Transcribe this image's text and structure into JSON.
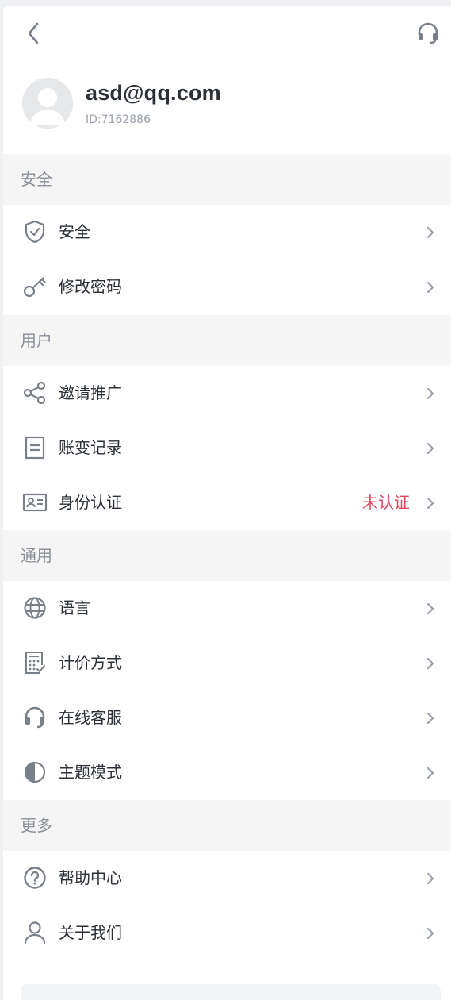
{
  "header": {
    "back_icon": "chevron-left-icon",
    "support_icon": "headset-icon"
  },
  "profile": {
    "email": "asd@qq.com",
    "uid": "ID:7162886"
  },
  "sections": {
    "security": {
      "title": "安全",
      "items": [
        {
          "label": "安全",
          "icon": "shield-icon"
        },
        {
          "label": "修改密码",
          "icon": "key-icon"
        }
      ]
    },
    "user": {
      "title": "用户",
      "items": [
        {
          "label": "邀请推广",
          "icon": "share-icon"
        },
        {
          "label": "账变记录",
          "icon": "document-icon"
        },
        {
          "label": "身份认证",
          "icon": "id-card-icon",
          "status": "未认证"
        }
      ]
    },
    "general": {
      "title": "通用",
      "items": [
        {
          "label": "语言",
          "icon": "globe-icon"
        },
        {
          "label": "计价方式",
          "icon": "calculator-icon"
        },
        {
          "label": "在线客服",
          "icon": "headset-icon"
        },
        {
          "label": "主题模式",
          "icon": "contrast-icon"
        }
      ]
    },
    "more": {
      "title": "更多",
      "items": [
        {
          "label": "帮助中心",
          "icon": "help-circle-icon"
        },
        {
          "label": "关于我们",
          "icon": "person-icon"
        }
      ]
    }
  },
  "colors": {
    "accent_warning": "#e0455e",
    "section_bg": "#f5f5f5",
    "icon_gray": "#8a9099"
  }
}
